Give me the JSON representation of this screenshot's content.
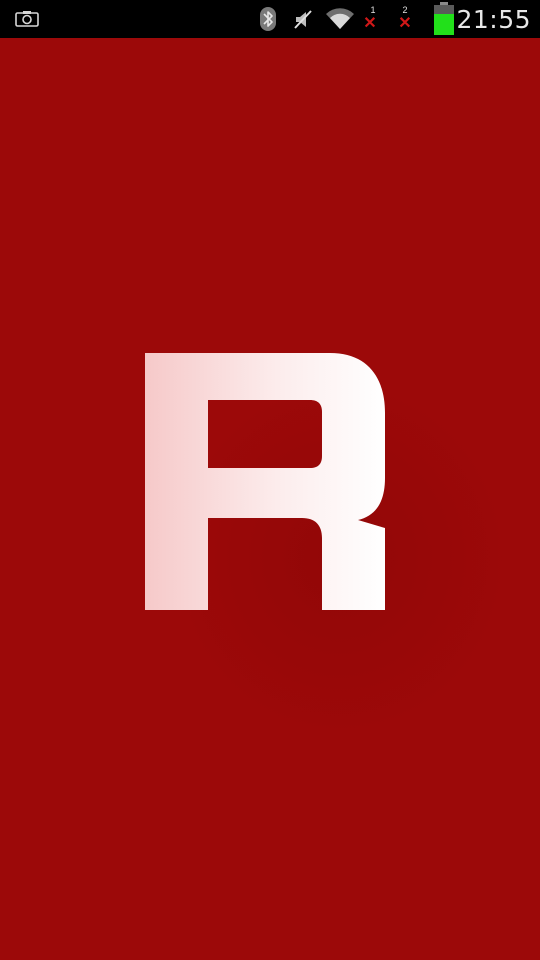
{
  "status_bar": {
    "time": "21:55",
    "sim1_label": "1",
    "sim2_label": "2",
    "battery_color": "#22e01a",
    "icons": [
      "screenshot-icon",
      "bluetooth-icon",
      "mute-icon",
      "wifi-icon",
      "no-signal-sim1-icon",
      "no-signal-sim2-icon",
      "battery-icon"
    ]
  },
  "splash": {
    "logo_letter": "R",
    "background_color": "#9c0909"
  }
}
